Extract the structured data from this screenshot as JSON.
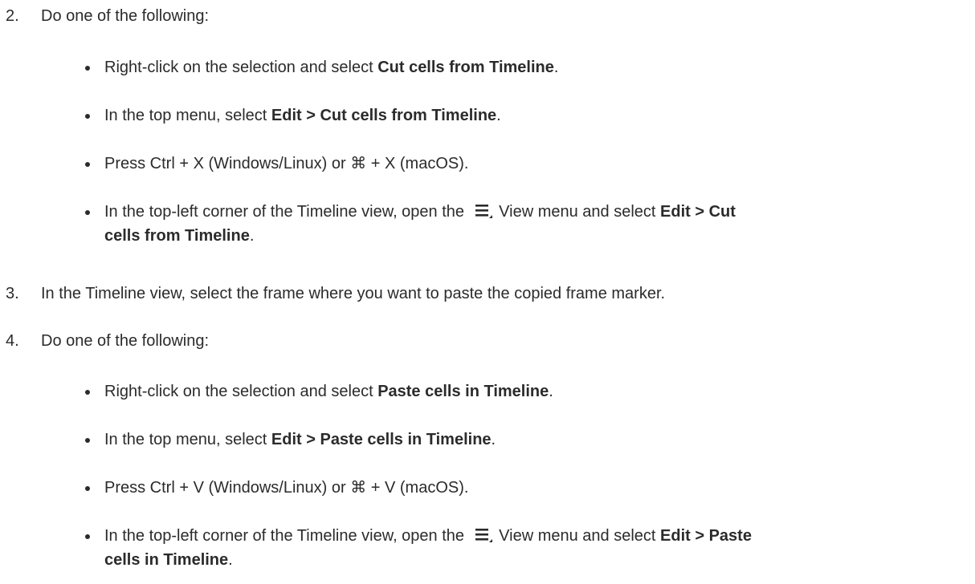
{
  "steps": [
    {
      "number": "2.",
      "text": "Do one of the following:",
      "bullets": [
        {
          "pre": "Right-click on the selection and select ",
          "bold": "Cut cells from Timeline",
          "post": "."
        },
        {
          "pre": "In the top menu, select ",
          "bold": "Edit > Cut cells from Timeline",
          "post": "."
        },
        {
          "pre": "Press Ctrl + X (Windows/Linux) or ⌘ + X (macOS).",
          "bold": "",
          "post": ""
        },
        {
          "pre": "In the top-left corner of the Timeline view, open the ",
          "icon": "hamburger-menu-icon",
          "mid": " View menu and select ",
          "bold": "Edit > Cut",
          "bold2": "cells from Timeline",
          "post": "."
        }
      ]
    },
    {
      "number": "3.",
      "text": "In the Timeline view, select the frame where you want to paste the copied frame marker."
    },
    {
      "number": "4.",
      "text": "Do one of the following:",
      "bullets": [
        {
          "pre": "Right-click on the selection and select ",
          "bold": "Paste cells in Timeline",
          "post": "."
        },
        {
          "pre": "In the top menu, select ",
          "bold": "Edit > Paste cells in Timeline",
          "post": "."
        },
        {
          "pre": "Press Ctrl + V (Windows/Linux) or ⌘ + V (macOS).",
          "bold": "",
          "post": ""
        },
        {
          "pre": "In the top-left corner of the Timeline view, open the ",
          "icon": "hamburger-menu-icon",
          "mid": " View menu and select ",
          "bold": "Edit > Paste",
          "bold2": "cells in Timeline",
          "post": "."
        }
      ]
    }
  ]
}
